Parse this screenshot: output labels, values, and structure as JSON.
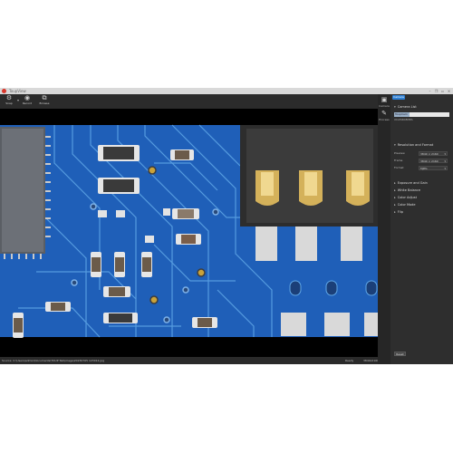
{
  "window": {
    "title": "ToupView",
    "min": "–",
    "restore": "❐",
    "max": "▫",
    "close": "×"
  },
  "toolbar": {
    "items": [
      {
        "label": "Snap",
        "icon": "gear-icon",
        "glyph": "⚙"
      },
      {
        "label": "Record",
        "icon": "record-icon",
        "glyph": "◉"
      },
      {
        "label": "Browse",
        "icon": "browse-icon",
        "glyph": "⧉"
      }
    ]
  },
  "rail": {
    "items": [
      {
        "label": "Camera",
        "icon": "camera-icon",
        "glyph": "▣"
      },
      {
        "label": "Process",
        "icon": "process-icon",
        "glyph": "✎"
      }
    ]
  },
  "panel": {
    "tab": "Camera",
    "camera_list": {
      "title": "Camera List",
      "selected": "ToupCam",
      "sub": "XCAM4K8MPA"
    },
    "resolution": {
      "title": "Resolution and Format",
      "rows": [
        {
          "label": "Preview",
          "value": "3840 × 2160"
        },
        {
          "label": "Frame",
          "value": "3840 × 2160"
        },
        {
          "label": "Format",
          "value": "MJPG"
        }
      ]
    },
    "sections": [
      "Exposure and Gain",
      "White Balance",
      "Color Adjust",
      "Color Mode",
      "Flip"
    ],
    "reset": "Reset"
  },
  "status": {
    "path": "Source: C:\\Users\\admin\\Documents\\TOUP Tek\\image\\20230705 123012.jpg",
    "mode": "Ready",
    "res": "3840x2160",
    "fps": "30.00 fps"
  },
  "colors": {
    "accent": "#2d7fd3",
    "board": "#1f5fb8",
    "trace": "#5fa6e6",
    "brand": "#d9372b"
  }
}
